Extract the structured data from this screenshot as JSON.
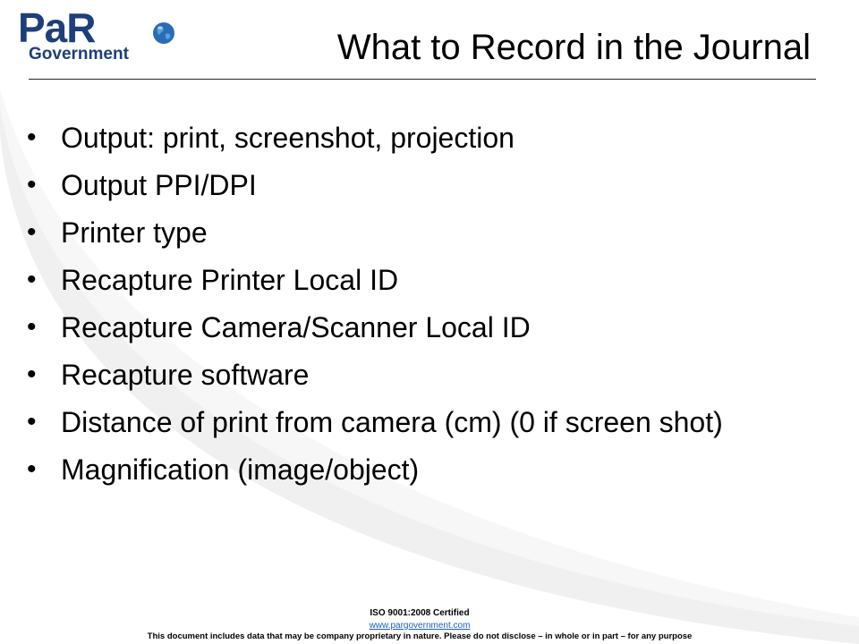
{
  "logo": {
    "wordmark": "PaR",
    "subtext": "Government"
  },
  "slide": {
    "title": "What to Record in the Journal",
    "bullets": [
      "Output: print, screenshot, projection",
      "Output PPI/DPI",
      "Printer type",
      "Recapture Printer Local ID",
      "Recapture Camera/Scanner Local ID",
      "Recapture software",
      "Distance of print from camera (cm) (0 if screen shot)",
      "Magnification (image/object)"
    ]
  },
  "footer": {
    "certification": "ISO 9001:2008 Certified",
    "url": "www.pargovernment.com",
    "disclaimer": "This document includes data that may be company proprietary in nature. Please do not disclose – in whole or in part – for any purpose"
  },
  "colors": {
    "logo_blue": "#1d3f7a",
    "link_blue": "#1a5fb4",
    "swoosh_gray": "#eeeeee"
  }
}
